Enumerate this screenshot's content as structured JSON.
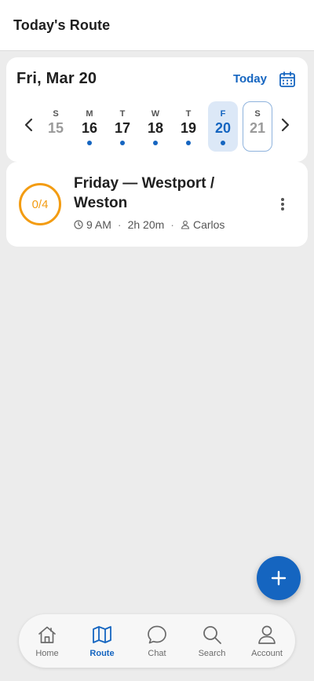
{
  "app_bar": {
    "title": "Today's Route"
  },
  "date_card": {
    "heading": "Fri, Mar 20",
    "today_label": "Today",
    "days": [
      {
        "dow": "S",
        "num": "15"
      },
      {
        "dow": "M",
        "num": "16"
      },
      {
        "dow": "T",
        "num": "17"
      },
      {
        "dow": "W",
        "num": "18"
      },
      {
        "dow": "T",
        "num": "19"
      },
      {
        "dow": "F",
        "num": "20"
      },
      {
        "dow": "S",
        "num": "21"
      }
    ]
  },
  "route": {
    "progress": "0/4",
    "title": "Friday — Westport / Weston",
    "time": "9 AM",
    "duration": "2h 20m",
    "driver": "Carlos"
  },
  "nav": {
    "items": [
      {
        "label": "Home",
        "icon": "home-icon"
      },
      {
        "label": "Route",
        "icon": "map-icon"
      },
      {
        "label": "Chat",
        "icon": "chat-icon"
      },
      {
        "label": "Search",
        "icon": "search-icon"
      },
      {
        "label": "Account",
        "icon": "account-icon"
      }
    ],
    "active": "Route"
  },
  "colors": {
    "accent": "#1565c0",
    "progress": "#f39c12",
    "background": "#ececec"
  }
}
